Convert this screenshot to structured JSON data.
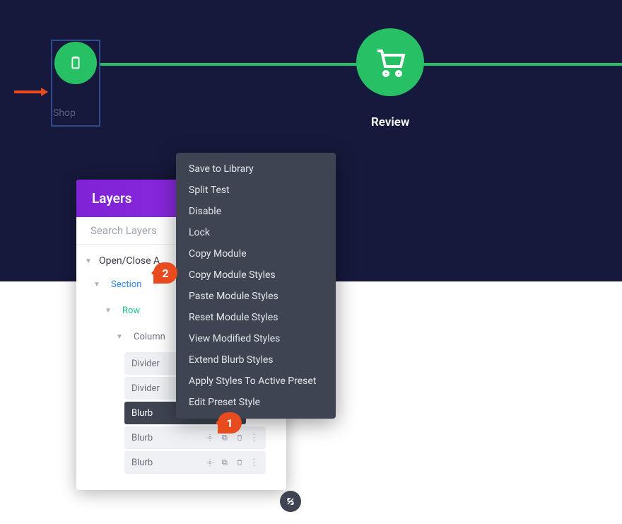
{
  "steps": {
    "step1_label": "Shop",
    "step2_label": "Review"
  },
  "layers_panel": {
    "title": "Layers",
    "search_placeholder": "Search Layers",
    "open_close": "Open/Close A",
    "tree": {
      "section": "Section",
      "row": "Row",
      "column": "Column",
      "leaves": [
        "Divider",
        "Divider",
        "Blurb",
        "Blurb",
        "Blurb"
      ],
      "active_index": 2
    }
  },
  "context_menu": {
    "items": [
      "Save to Library",
      "Split Test",
      "Disable",
      "Lock",
      "Copy Module",
      "Copy Module Styles",
      "Paste Module Styles",
      "Reset Module Styles",
      "View Modified Styles",
      "Extend Blurb Styles",
      "Apply Styles To Active Preset",
      "Edit Preset Style"
    ]
  },
  "callouts": {
    "c1": "1",
    "c2": "2"
  },
  "icons": {
    "clipboard": "clipboard-icon",
    "cart": "cart-icon",
    "gear": "gear-icon",
    "duplicate": "duplicate-icon",
    "trash": "trash-icon",
    "more": "more-icon",
    "plus": "plus-icon",
    "resize": "resize-icon",
    "arrow": "arrow-icon"
  }
}
